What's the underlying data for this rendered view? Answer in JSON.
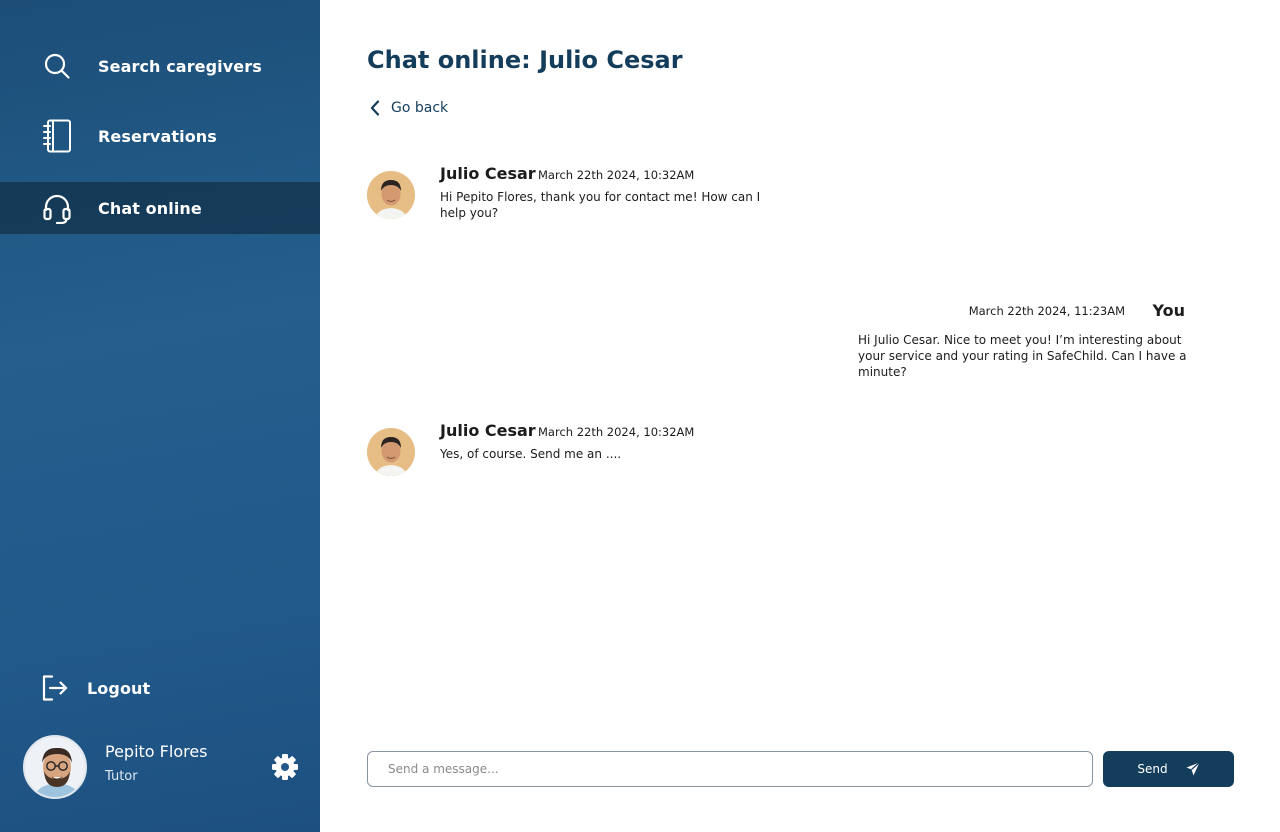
{
  "sidebar": {
    "items": [
      {
        "label": "Search caregivers",
        "icon": "search-icon",
        "active": false
      },
      {
        "label": "Reservations",
        "icon": "notebook-icon",
        "active": false
      },
      {
        "label": "Chat online",
        "icon": "headset-icon",
        "active": true
      }
    ],
    "logout_label": "Logout",
    "user": {
      "name": "Pepito Flores",
      "role": "Tutor"
    }
  },
  "main": {
    "title": "Chat online: Julio Cesar",
    "go_back_label": "Go back",
    "messages": [
      {
        "sender": "Julio Cesar",
        "time": "March 22th 2024, 10:32AM",
        "text": "Hi Pepito Flores, thank you for contact me! How can I help you?"
      },
      {
        "sender": "You",
        "time": "March 22th 2024, 11:23AM",
        "text": "Hi Julio Cesar. Nice to meet you! I’m interesting about your service and your rating in SafeChild. Can I have a minute?"
      },
      {
        "sender": "Julio Cesar",
        "time": "March 22th 2024, 10:32AM",
        "text": "Yes, of course. Send me an ...."
      }
    ],
    "composer": {
      "placeholder": "Send a message...",
      "value": "",
      "send_label": "Send"
    }
  },
  "colors": {
    "sidebar": "#235b89",
    "active_item": "#173b58",
    "accent": "#143d5c"
  }
}
